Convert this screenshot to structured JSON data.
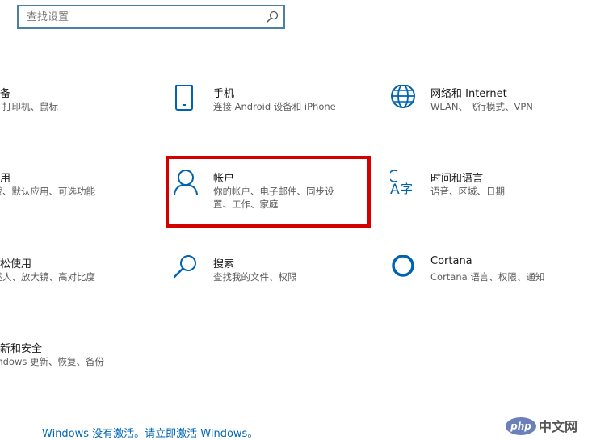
{
  "search": {
    "placeholder": "查找设置"
  },
  "tiles": [
    {
      "title": "设备",
      "desc": "牙、打印机、鼠标"
    },
    {
      "title": "手机",
      "desc": "连接 Android 设备和 iPhone"
    },
    {
      "title": "网络和 Internet",
      "desc": "WLAN、飞行模式、VPN"
    },
    {
      "title": "应用",
      "desc": "卸载、默认应用、可选功能"
    },
    {
      "title": "帐户",
      "desc": "你的帐户、电子邮件、同步设置、工作、家庭"
    },
    {
      "title": "时间和语言",
      "desc": "语音、区域、日期"
    },
    {
      "title": "轻松使用",
      "desc": "讲述人、放大镜、高对比度"
    },
    {
      "title": "搜索",
      "desc": "查找我的文件、权限"
    },
    {
      "title": "Cortana",
      "desc": "Cortana 语言、权限、通知"
    },
    {
      "title": "更新和安全",
      "desc": "Windows 更新、恢复、备份"
    }
  ],
  "activation": {
    "text": "Windows 没有激活。请立即激活 Windows。"
  },
  "watermark": {
    "text": "php 中文网"
  },
  "colors": {
    "accent": "#0067b8",
    "icon": "#0063b1",
    "highlight": "#d40000"
  }
}
